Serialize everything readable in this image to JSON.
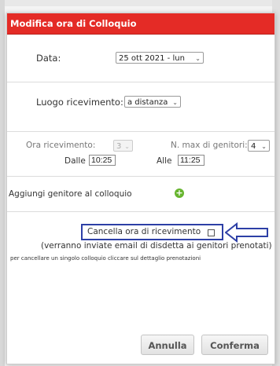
{
  "dialog": {
    "title": "Modifica ora di Colloquio",
    "title_bg": "#e42b26"
  },
  "date": {
    "label": "Data:",
    "value": "25 ott 2021 - lun"
  },
  "location": {
    "label": "Luogo ricevimento:",
    "value": "a distanza"
  },
  "hour": {
    "label": "Ora ricevimento:",
    "value": "3",
    "max_parents_label": "N. max di genitori:",
    "max_parents_value": "4",
    "from_label": "Dalle",
    "from_value": "10:25",
    "to_label": "Alle",
    "to_value": "11:25"
  },
  "add_parent": {
    "label": "Aggiungi genitore al colloquio",
    "icon": "plus-circle-icon"
  },
  "cancel": {
    "label": "Cancella ora di ricevimento",
    "note": "(verranno inviate email di disdetta ai genitori prenotati)",
    "hint": "per cancellare un singolo colloquio cliccare sul dettaglio prenotazioni",
    "checked": false,
    "annotation_color": "#2d3fa6"
  },
  "buttons": {
    "cancel": "Annulla",
    "confirm": "Conferma"
  }
}
